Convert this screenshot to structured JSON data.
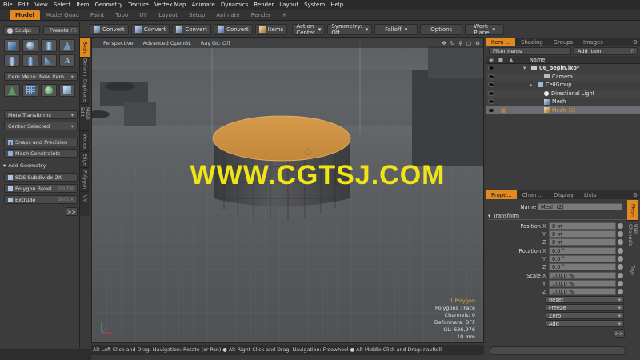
{
  "menu": [
    "File",
    "Edit",
    "View",
    "Select",
    "Item",
    "Geometry",
    "Texture",
    "Vertex Map",
    "Animate",
    "Dynamics",
    "Render",
    "Layout",
    "System",
    "Help"
  ],
  "layout_tabs": [
    "Model",
    "Model Quad",
    "Paint",
    "Topo",
    "UV",
    "Layout",
    "Setup",
    "Animate",
    "Render"
  ],
  "layout_add": "+",
  "toolbox": {
    "sculpt": "Sculpt",
    "presets": "Presets",
    "presets_key": "F6",
    "item_menu": "Item Menu: New Item",
    "more_transforms": "More Transforms",
    "center_selected": "Center Selected",
    "snaps": "Snaps and Precision",
    "constraints": "Mesh Constraints",
    "add_geometry": "Add Geometry",
    "sds": "SDS Subdivide 2X",
    "bevel": "Polygon Bevel",
    "bevel_key": "Shift-B",
    "extrude": "Extrude",
    "extrude_key": "Shift-X",
    "expand": ">>"
  },
  "vtabs": [
    "Basic",
    "Deform",
    "Duplicate",
    "Mesh Edit",
    "Vertex",
    "Edge",
    "Polygon",
    "UV"
  ],
  "top_toolbar": {
    "convert_labels": [
      "Convert",
      "Convert",
      "Convert",
      "Convert"
    ],
    "items": "Items",
    "action_center": "Action Center",
    "symmetry": "Symmetry: Off",
    "falloff": "Falloff",
    "options": "Options",
    "work_plane": "Work Plane"
  },
  "viewport": {
    "view": "Perspective",
    "shading": "Advanced OpenGL",
    "raygl": "Ray GL: Off",
    "watermark": "WWW.CGTSJ.COM",
    "stats": [
      "1 Polygon",
      "Polygons : Face",
      "Channels: 0",
      "Deformers: OFF",
      "GL: 636,976",
      "10 mm"
    ]
  },
  "status_bar": "Alt-Left Click and Drag: Navigation: Rotate (or Pan) ● Alt-Right Click and Drag: Navigation: Freewheel ● Alt-Middle Click and Drag: navRoll",
  "item_panel": {
    "tabs": [
      "Item ...",
      "Shading",
      "Groups",
      "Images"
    ],
    "filter": "Filter Items",
    "add_item": "Add Item",
    "add_item_key": "F",
    "column_name": "Name",
    "tree": [
      {
        "name": "06_begin.lxo*",
        "depth": 0,
        "bold": true
      },
      {
        "name": "Camera",
        "depth": 2
      },
      {
        "name": "CellGroup",
        "depth": 1
      },
      {
        "name": "Directional Light",
        "depth": 2
      },
      {
        "name": "Mesh",
        "depth": 2
      },
      {
        "name": "Mesh",
        "depth": 2,
        "suffix": "(2)",
        "selected": true
      }
    ]
  },
  "prop_panel": {
    "tabs": [
      "Prope...",
      "Chan ...",
      "Display",
      "Lists"
    ],
    "name_label": "Name",
    "name_value": "Mesh (2)",
    "section": "Transform",
    "rows": [
      {
        "label": "Position",
        "axis": "X",
        "value": "0 m"
      },
      {
        "label": "",
        "axis": "Y",
        "value": "0 m"
      },
      {
        "label": "",
        "axis": "Z",
        "value": "0 m"
      },
      {
        "label": "Rotation",
        "axis": "X",
        "value": "0.0 °"
      },
      {
        "label": "",
        "axis": "Y",
        "value": "0.0 °"
      },
      {
        "label": "",
        "axis": "Z",
        "value": "0.0 °"
      },
      {
        "label": "Scale",
        "axis": "X",
        "value": "100.0 %"
      },
      {
        "label": "",
        "axis": "Y",
        "value": "100.0 %"
      },
      {
        "label": "",
        "axis": "Z",
        "value": "100.0 %"
      }
    ],
    "actions": [
      "Reset",
      "Freeze",
      "Zero",
      "Add"
    ],
    "expand": ">>",
    "side_tabs": [
      "Mesh",
      "User Channels",
      "Tags"
    ]
  },
  "colors": {
    "accent": "#e18a22",
    "watermark": "#f0e419",
    "selected_top": "#c8893a"
  }
}
